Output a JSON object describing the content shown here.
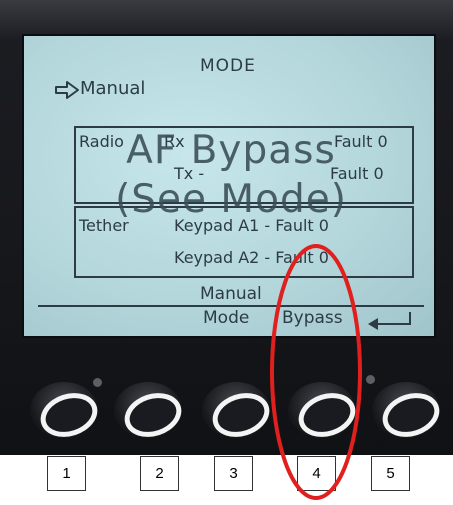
{
  "screen": {
    "title": "MODE",
    "selected_mode": "Manual",
    "overlay_line1": "AF Bypass",
    "overlay_line2": "(See Mode)",
    "radio_box": {
      "label": "Radio",
      "rx_label": "Rx",
      "rx_fault": "Fault 0",
      "tx_label": "Tx -",
      "tx_fault": "Fault 0"
    },
    "tether_box": {
      "label": "Tether",
      "keypad_a1": "Keypad A1 - Fault 0",
      "keypad_a2": "Keypad A2 - Fault 0"
    },
    "softkeys": {
      "manual_label": "Manual",
      "mode_label": "Mode",
      "bypass_label": "Bypass"
    }
  },
  "buttons": [
    {
      "number": "1"
    },
    {
      "number": "2"
    },
    {
      "number": "3"
    },
    {
      "number": "4"
    },
    {
      "number": "5"
    }
  ],
  "icons": {
    "selection_pointer": "arrow-right-outline-icon",
    "enter_key": "enter-arrow-icon"
  },
  "colors": {
    "lcd_background": "#b4d7dc",
    "lcd_text": "#2d3c44",
    "bezel": "#16171b",
    "highlight": "#e0201e"
  }
}
